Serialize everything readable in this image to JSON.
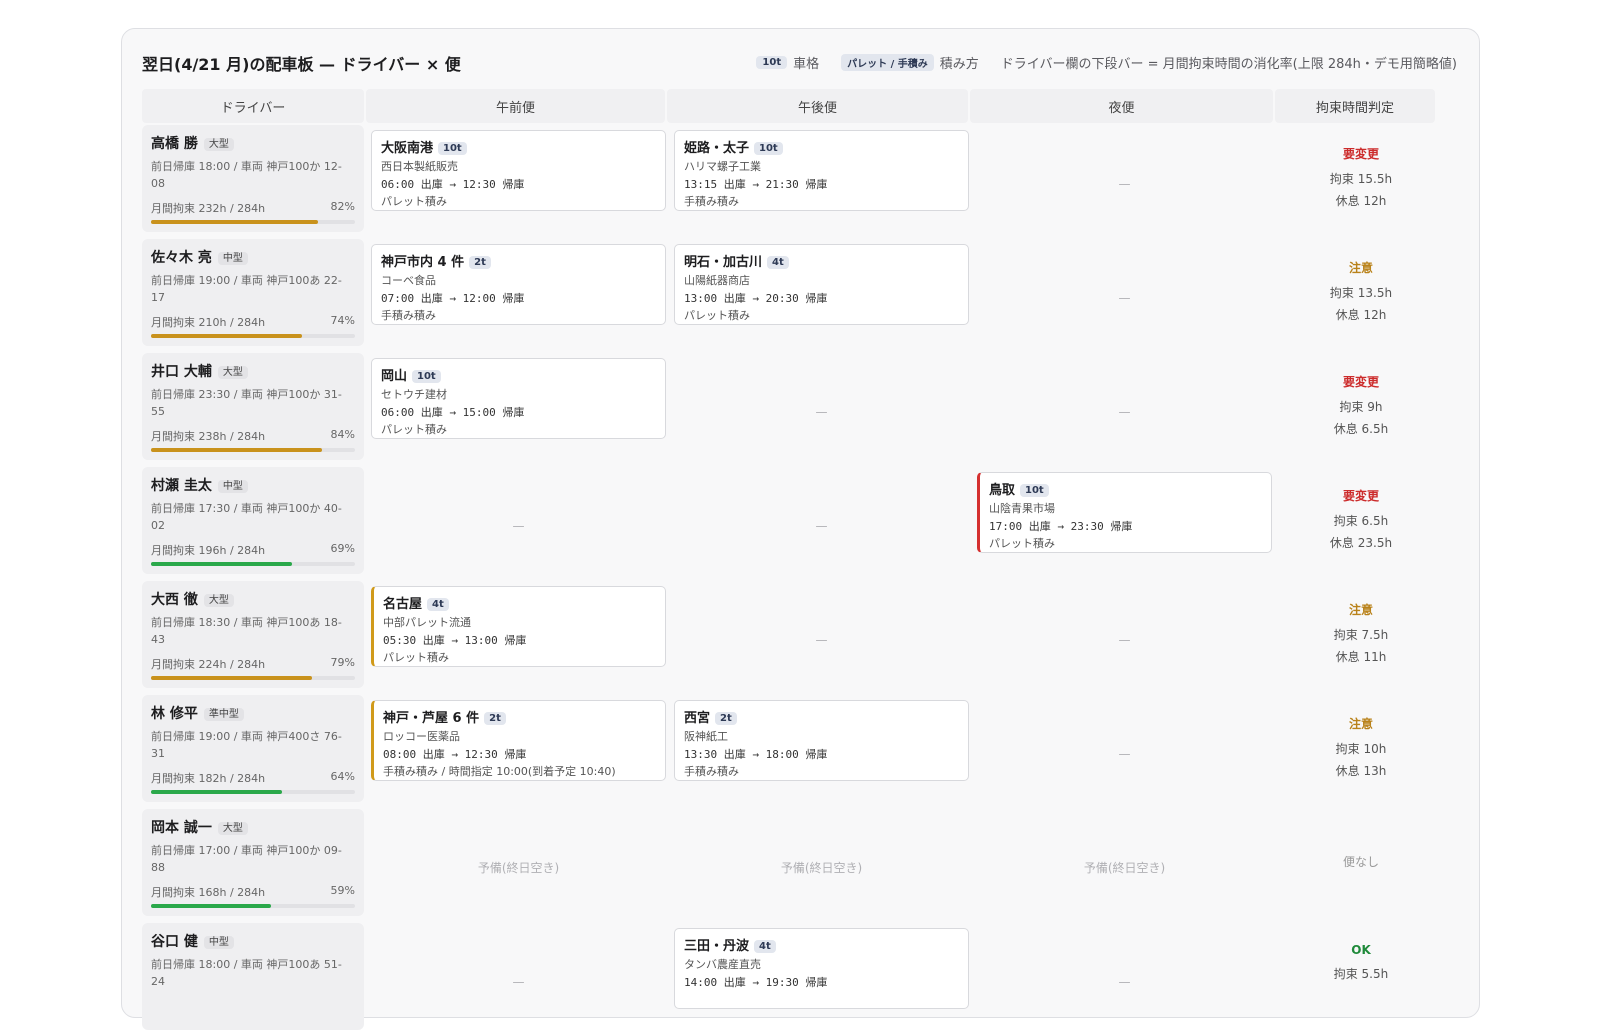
{
  "title": "翌日(4/21 月)の配車板 — ドライバー × 便",
  "legend": {
    "vehicle_chip": "10t",
    "vehicle_text": "車格",
    "load_chip": "パレット / 手積み",
    "load_text": "積み方",
    "note": "ドライバー欄の下段バー = 月間拘束時間の消化率(上限 284h・デモ用簡略値)"
  },
  "headers": [
    "ドライバー",
    "午前便",
    "午後便",
    "夜便",
    "拘束時間判定"
  ],
  "colors": {
    "bar_warn": "#c9921c",
    "bar_ok": "#2aa84a",
    "status_red": "#cc2b2b",
    "status_amber": "#b9821a",
    "status_green": "#1f8a3a"
  },
  "drivers": [
    {
      "name": "高橋 勝",
      "cls": "大型",
      "prev": "前日帰庫 18:00 / 車両 神戸100か 12-08",
      "monthly": "月間拘束 232h / 284h",
      "pct_text": "82%",
      "pct": 82,
      "bar": "warn",
      "am": {
        "dest": "大阪南港",
        "size": "10t",
        "cust": "西日本製紙販売",
        "time": "06:00 出庫 → 12:30 帰庫",
        "load": "パレット積み",
        "flag": ""
      },
      "pm": {
        "dest": "姫路・太子",
        "size": "10t",
        "cust": "ハリマ螺子工業",
        "time": "13:15 出庫 → 21:30 帰庫",
        "load": "手積み積み",
        "flag": ""
      },
      "night": null,
      "empty_text": "—",
      "judge": {
        "status": "要変更",
        "level": "red",
        "hours": "拘束 15.5h",
        "rest": "休息 12h"
      }
    },
    {
      "name": "佐々木 亮",
      "cls": "中型",
      "prev": "前日帰庫 19:00 / 車両 神戸100あ 22-17",
      "monthly": "月間拘束 210h / 284h",
      "pct_text": "74%",
      "pct": 74,
      "bar": "warn",
      "am": {
        "dest": "神戸市内 4 件",
        "size": "2t",
        "cust": "コーベ食品",
        "time": "07:00 出庫 → 12:00 帰庫",
        "load": "手積み積み",
        "flag": ""
      },
      "pm": {
        "dest": "明石・加古川",
        "size": "4t",
        "cust": "山陽紙器商店",
        "time": "13:00 出庫 → 20:30 帰庫",
        "load": "パレット積み",
        "flag": ""
      },
      "night": null,
      "empty_text": "—",
      "judge": {
        "status": "注意",
        "level": "amber",
        "hours": "拘束 13.5h",
        "rest": "休息 12h"
      }
    },
    {
      "name": "井口 大輔",
      "cls": "大型",
      "prev": "前日帰庫 23:30 / 車両 神戸100か 31-55",
      "monthly": "月間拘束 238h / 284h",
      "pct_text": "84%",
      "pct": 84,
      "bar": "warn",
      "am": {
        "dest": "岡山",
        "size": "10t",
        "cust": "セトウチ建材",
        "time": "06:00 出庫 → 15:00 帰庫",
        "load": "パレット積み",
        "flag": ""
      },
      "pm": null,
      "night": null,
      "empty_text": "—",
      "judge": {
        "status": "要変更",
        "level": "red",
        "hours": "拘束 9h",
        "rest": "休息 6.5h"
      }
    },
    {
      "name": "村瀬 圭太",
      "cls": "中型",
      "prev": "前日帰庫 17:30 / 車両 神戸100か 40-02",
      "monthly": "月間拘束 196h / 284h",
      "pct_text": "69%",
      "pct": 69,
      "bar": "ok",
      "am": null,
      "pm": null,
      "night": {
        "dest": "鳥取",
        "size": "10t",
        "cust": "山陰青果市場",
        "time": "17:00 出庫 → 23:30 帰庫",
        "load": "パレット積み",
        "flag": "err"
      },
      "empty_text": "—",
      "judge": {
        "status": "要変更",
        "level": "red",
        "hours": "拘束 6.5h",
        "rest": "休息 23.5h"
      }
    },
    {
      "name": "大西 徹",
      "cls": "大型",
      "prev": "前日帰庫 18:30 / 車両 神戸100あ 18-43",
      "monthly": "月間拘束 224h / 284h",
      "pct_text": "79%",
      "pct": 79,
      "bar": "warn",
      "am": {
        "dest": "名古屋",
        "size": "4t",
        "cust": "中部パレット流通",
        "time": "05:30 出庫 → 13:00 帰庫",
        "load": "パレット積み",
        "flag": "warn"
      },
      "pm": null,
      "night": null,
      "empty_text": "—",
      "judge": {
        "status": "注意",
        "level": "amber",
        "hours": "拘束 7.5h",
        "rest": "休息 11h"
      }
    },
    {
      "name": "林 修平",
      "cls": "準中型",
      "prev": "前日帰庫 19:00 / 車両 神戸400さ 76-31",
      "monthly": "月間拘束 182h / 284h",
      "pct_text": "64%",
      "pct": 64,
      "bar": "ok",
      "am": {
        "dest": "神戸・芦屋 6 件",
        "size": "2t",
        "cust": "ロッコー医薬品",
        "time": "08:00 出庫 → 12:30 帰庫",
        "load": "手積み積み / 時間指定 10:00(到着予定 10:40)",
        "flag": "warn"
      },
      "pm": {
        "dest": "西宮",
        "size": "2t",
        "cust": "阪神紙工",
        "time": "13:30 出庫 → 18:00 帰庫",
        "load": "手積み積み",
        "flag": ""
      },
      "night": null,
      "empty_text": "—",
      "judge": {
        "status": "注意",
        "level": "amber",
        "hours": "拘束 10h",
        "rest": "休息 13h"
      }
    },
    {
      "name": "岡本 誠一",
      "cls": "大型",
      "prev": "前日帰庫 17:00 / 車両 神戸100か 09-88",
      "monthly": "月間拘束 168h / 284h",
      "pct_text": "59%",
      "pct": 59,
      "bar": "ok",
      "am": null,
      "pm": null,
      "night": null,
      "empty_text": "予備(終日空き)",
      "judge": {
        "status": "",
        "level": "",
        "hours": "",
        "rest": "",
        "note": "便なし"
      }
    },
    {
      "name": "谷口 健",
      "cls": "中型",
      "prev": "前日帰庫 18:00 / 車両 神戸100あ 51-24",
      "monthly": "",
      "pct_text": "",
      "pct": 0,
      "bar": "ok",
      "am": null,
      "pm": {
        "dest": "三田・丹波",
        "size": "4t",
        "cust": "タンバ農産直売",
        "time": "14:00 出庫 → 19:30 帰庫",
        "load": "",
        "flag": ""
      },
      "night": null,
      "empty_text": "—",
      "judge": {
        "status": "OK",
        "level": "green",
        "hours": "拘束 5.5h",
        "rest": ""
      }
    }
  ]
}
